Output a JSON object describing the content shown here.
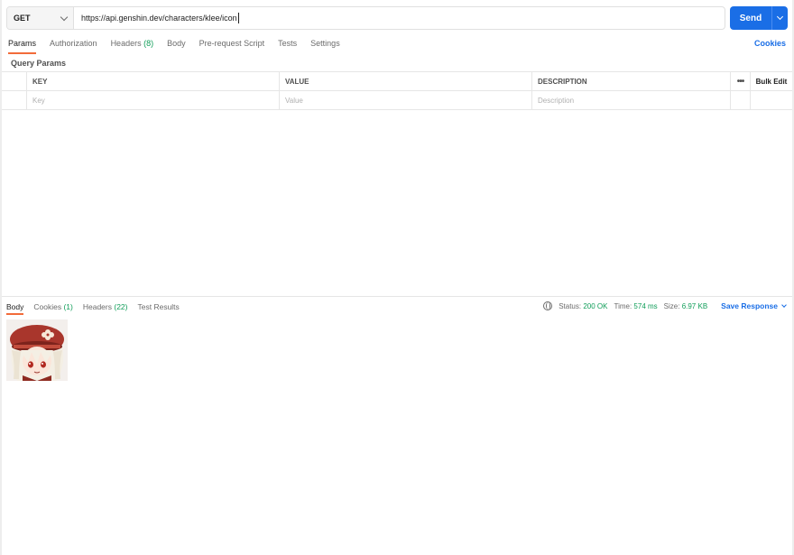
{
  "request": {
    "method": "GET",
    "url": "https://api.genshin.dev/characters/klee/icon",
    "send_label": "Send"
  },
  "request_tabs": [
    {
      "label": "Params",
      "count": "",
      "active": true
    },
    {
      "label": "Authorization",
      "count": "",
      "active": false
    },
    {
      "label": "Headers",
      "count": "(8)",
      "active": false
    },
    {
      "label": "Body",
      "count": "",
      "active": false
    },
    {
      "label": "Pre-request Script",
      "count": "",
      "active": false
    },
    {
      "label": "Tests",
      "count": "",
      "active": false
    },
    {
      "label": "Settings",
      "count": "",
      "active": false
    }
  ],
  "cookies_label": "Cookies",
  "query_params": {
    "section_label": "Query Params",
    "headers": {
      "key": "KEY",
      "value": "VALUE",
      "description": "DESCRIPTION",
      "bulk_edit": "Bulk Edit"
    },
    "placeholders": {
      "key": "Key",
      "value": "Value",
      "description": "Description"
    }
  },
  "response_tabs": [
    {
      "label": "Body",
      "count": "",
      "active": true
    },
    {
      "label": "Cookies",
      "count": "(1)",
      "active": false
    },
    {
      "label": "Headers",
      "count": "(22)",
      "active": false
    },
    {
      "label": "Test Results",
      "count": "",
      "active": false
    }
  ],
  "response_meta": {
    "status_label": "Status:",
    "status_value": "200 OK",
    "time_label": "Time:",
    "time_value": "574 ms",
    "size_label": "Size:",
    "size_value": "6.97 KB",
    "save_label": "Save Response"
  },
  "colors": {
    "accent": "#1a6ee6",
    "active_tab_underline": "#f26b3a",
    "success": "#0f9d58"
  },
  "icons": {
    "method_dropdown": "chevron-down-icon",
    "globe": "globe-icon",
    "more": "more-horizontal-icon"
  }
}
